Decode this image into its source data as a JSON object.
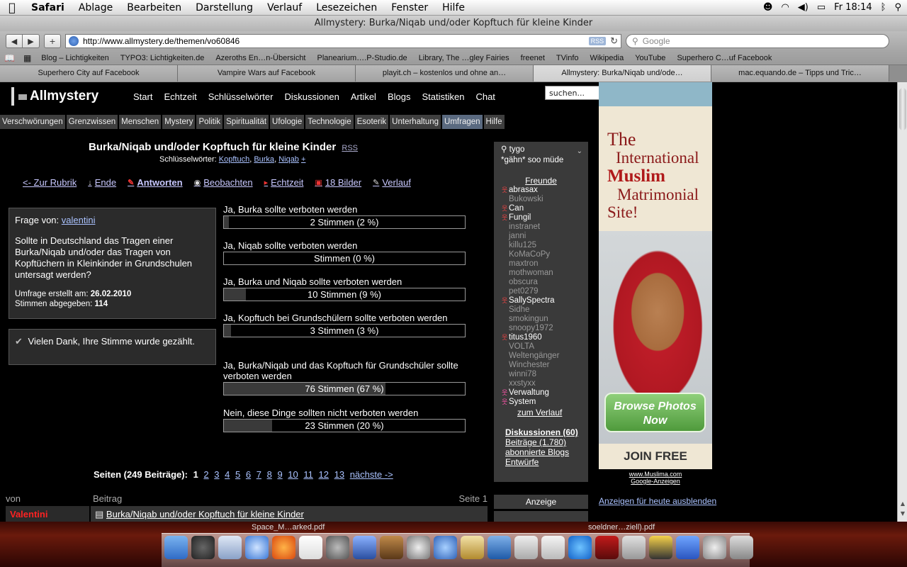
{
  "menubar": {
    "apple": "",
    "items": [
      "Safari",
      "Ablage",
      "Bearbeiten",
      "Darstellung",
      "Verlauf",
      "Lesezeichen",
      "Fenster",
      "Hilfe"
    ],
    "clock": "Fr 18:14"
  },
  "window": {
    "title": "Allmystery: Burka/Niqab und/oder Kopftuch für kleine Kinder"
  },
  "toolbar": {
    "url": "http://www.allmystery.de/themen/vo60846",
    "rss": "RSS",
    "search_placeholder": "Google"
  },
  "bookmarks": [
    "Blog – Lichtigkeiten",
    "TYPO3: Lichtigkeiten.de",
    "Azeroths En…n-Übersicht",
    "Planearium….P-Studio.de",
    "Library, The …gley Fairies",
    "freenet",
    "TVinfo",
    "Wikipedia",
    "YouTube",
    "Superhero C…uf Facebook"
  ],
  "tabs": [
    "Superhero City auf Facebook",
    "Vampire Wars auf Facebook",
    "playit.ch – kostenlos und ohne an…",
    "Allmystery: Burka/Niqab und/ode…",
    "mac.equando.de – Tipps und Tric…"
  ],
  "site": {
    "logo": "Allmystery",
    "nav": [
      "Start",
      "Echtzeit",
      "Schlüsselwörter",
      "Diskussionen",
      "Artikel",
      "Blogs",
      "Statistiken",
      "Chat"
    ],
    "search_value": "suchen...",
    "categories": [
      "Verschwörungen",
      "Grenzwissen",
      "Menschen",
      "Mystery",
      "Politik",
      "Spiritualität",
      "Ufologie",
      "Technologie",
      "Esoterik",
      "Unterhaltung",
      "Umfragen",
      "Hilfe"
    ]
  },
  "thread": {
    "title": "Burka/Niqab und/oder Kopftuch für kleine Kinder",
    "rss": "RSS",
    "keywords_label": "Schlüsselwörter:",
    "keywords": [
      "Kopftuch",
      "Burka",
      "Niqab"
    ],
    "keywords_sep": ",",
    "keyword_add": "+",
    "actions": [
      "<- Zur Rubrik",
      "Ende",
      "Antworten",
      "Beobachten",
      "Echtzeit",
      "18 Bilder",
      "Verlauf"
    ]
  },
  "question": {
    "from_label": "Frage von:",
    "from_user": "valentini",
    "text": "Sollte in Deutschland das Tragen einer Burka/Niqab und/oder das Tragen von Kopftüchern in Kleinkinder in Grundschulen untersagt werden?",
    "created_label": "Umfrage erstellt am:",
    "created": "26.02.2010",
    "votes_label": "Stimmen abgegeben:",
    "votes": "114"
  },
  "thanks": "Vielen Dank, Ihre Stimme wurde gezählt.",
  "poll": [
    {
      "label": "Ja, Burka sollte verboten werden",
      "result": "2 Stimmen (2 %)",
      "percent": 2
    },
    {
      "label": "Ja, Niqab sollte verboten werden",
      "result": "Stimmen (0 %)",
      "percent": 0
    },
    {
      "label": "Ja, Burka und Niqab sollte verboten werden",
      "result": "10 Stimmen (9 %)",
      "percent": 9
    },
    {
      "label": "Ja, Kopftuch bei Grundschülern sollte verboten werden",
      "result": "3 Stimmen (3 %)",
      "percent": 3
    },
    {
      "label": "Ja, Burka/Niqab und das Kopftuch für Grundschüler sollte verboten werden",
      "result": "76 Stimmen (67 %)",
      "percent": 67
    },
    {
      "label": "Nein, diese Dinge sollten nicht verboten werden",
      "result": "23 Stimmen (20 %)",
      "percent": 20
    }
  ],
  "pagination": {
    "label": "Seiten (249 Beiträge):",
    "current": "1",
    "pages": [
      "2",
      "3",
      "4",
      "5",
      "6",
      "7",
      "8",
      "9",
      "10",
      "11",
      "12",
      "13"
    ],
    "next": "nächste ->"
  },
  "table": {
    "col_author": "von",
    "col_post": "Beitrag",
    "page": "Seite 1",
    "first_author": "Valentini",
    "first_title": "Burka/Niqab und/oder Kopftuch für kleine Kinder"
  },
  "sidebar": {
    "user": "tygo",
    "status": "*gähn* soo müde",
    "friends_heading": "Freunde",
    "friends": [
      {
        "name": "abrasax",
        "online": true
      },
      {
        "name": "Bukowski",
        "online": false
      },
      {
        "name": "Can",
        "online": true
      },
      {
        "name": "Fungil",
        "online": true
      },
      {
        "name": "instranet",
        "online": false
      },
      {
        "name": "janni",
        "online": false
      },
      {
        "name": "killu125",
        "online": false
      },
      {
        "name": "KoMaCoPy",
        "online": false
      },
      {
        "name": "maxtron",
        "online": false
      },
      {
        "name": "mothwoman",
        "online": false
      },
      {
        "name": "obscura",
        "online": false
      },
      {
        "name": "pet0279",
        "online": false
      },
      {
        "name": "SallySpectra",
        "online": true
      },
      {
        "name": "Sidhe",
        "online": false
      },
      {
        "name": "smokingun",
        "online": false
      },
      {
        "name": "snoopy1972",
        "online": false
      },
      {
        "name": "titus1960",
        "online": true
      },
      {
        "name": "VOLTA",
        "online": false
      },
      {
        "name": "Weltengänger",
        "online": false
      },
      {
        "name": "Winchester",
        "online": false
      },
      {
        "name": "winni78",
        "online": false
      },
      {
        "name": "xxstyxx",
        "online": false
      },
      {
        "name": "Verwaltung",
        "online": true
      },
      {
        "name": "System",
        "online": true
      }
    ],
    "verlauf": "zum Verlauf",
    "discussions": "Diskussionen (60)",
    "links": [
      "Beiträge (1.780)",
      "abonnierte Blogs",
      "Entwürfe"
    ],
    "ad_label": "Anzeige"
  },
  "ad": {
    "line1": "The",
    "line2": "International",
    "line3": "Muslim",
    "line4": "Matrimonial",
    "line5": "Site!",
    "button": "Browse Photos Now",
    "join": "JOIN FREE",
    "credit1": "www.Muslima.com",
    "credit2": "Google-Anzeigen",
    "hide": "Anzeigen für heute ausblenden"
  },
  "dock": {
    "file1": "Space_M…arked.pdf",
    "file2": "soeldner…ziell).pdf"
  }
}
